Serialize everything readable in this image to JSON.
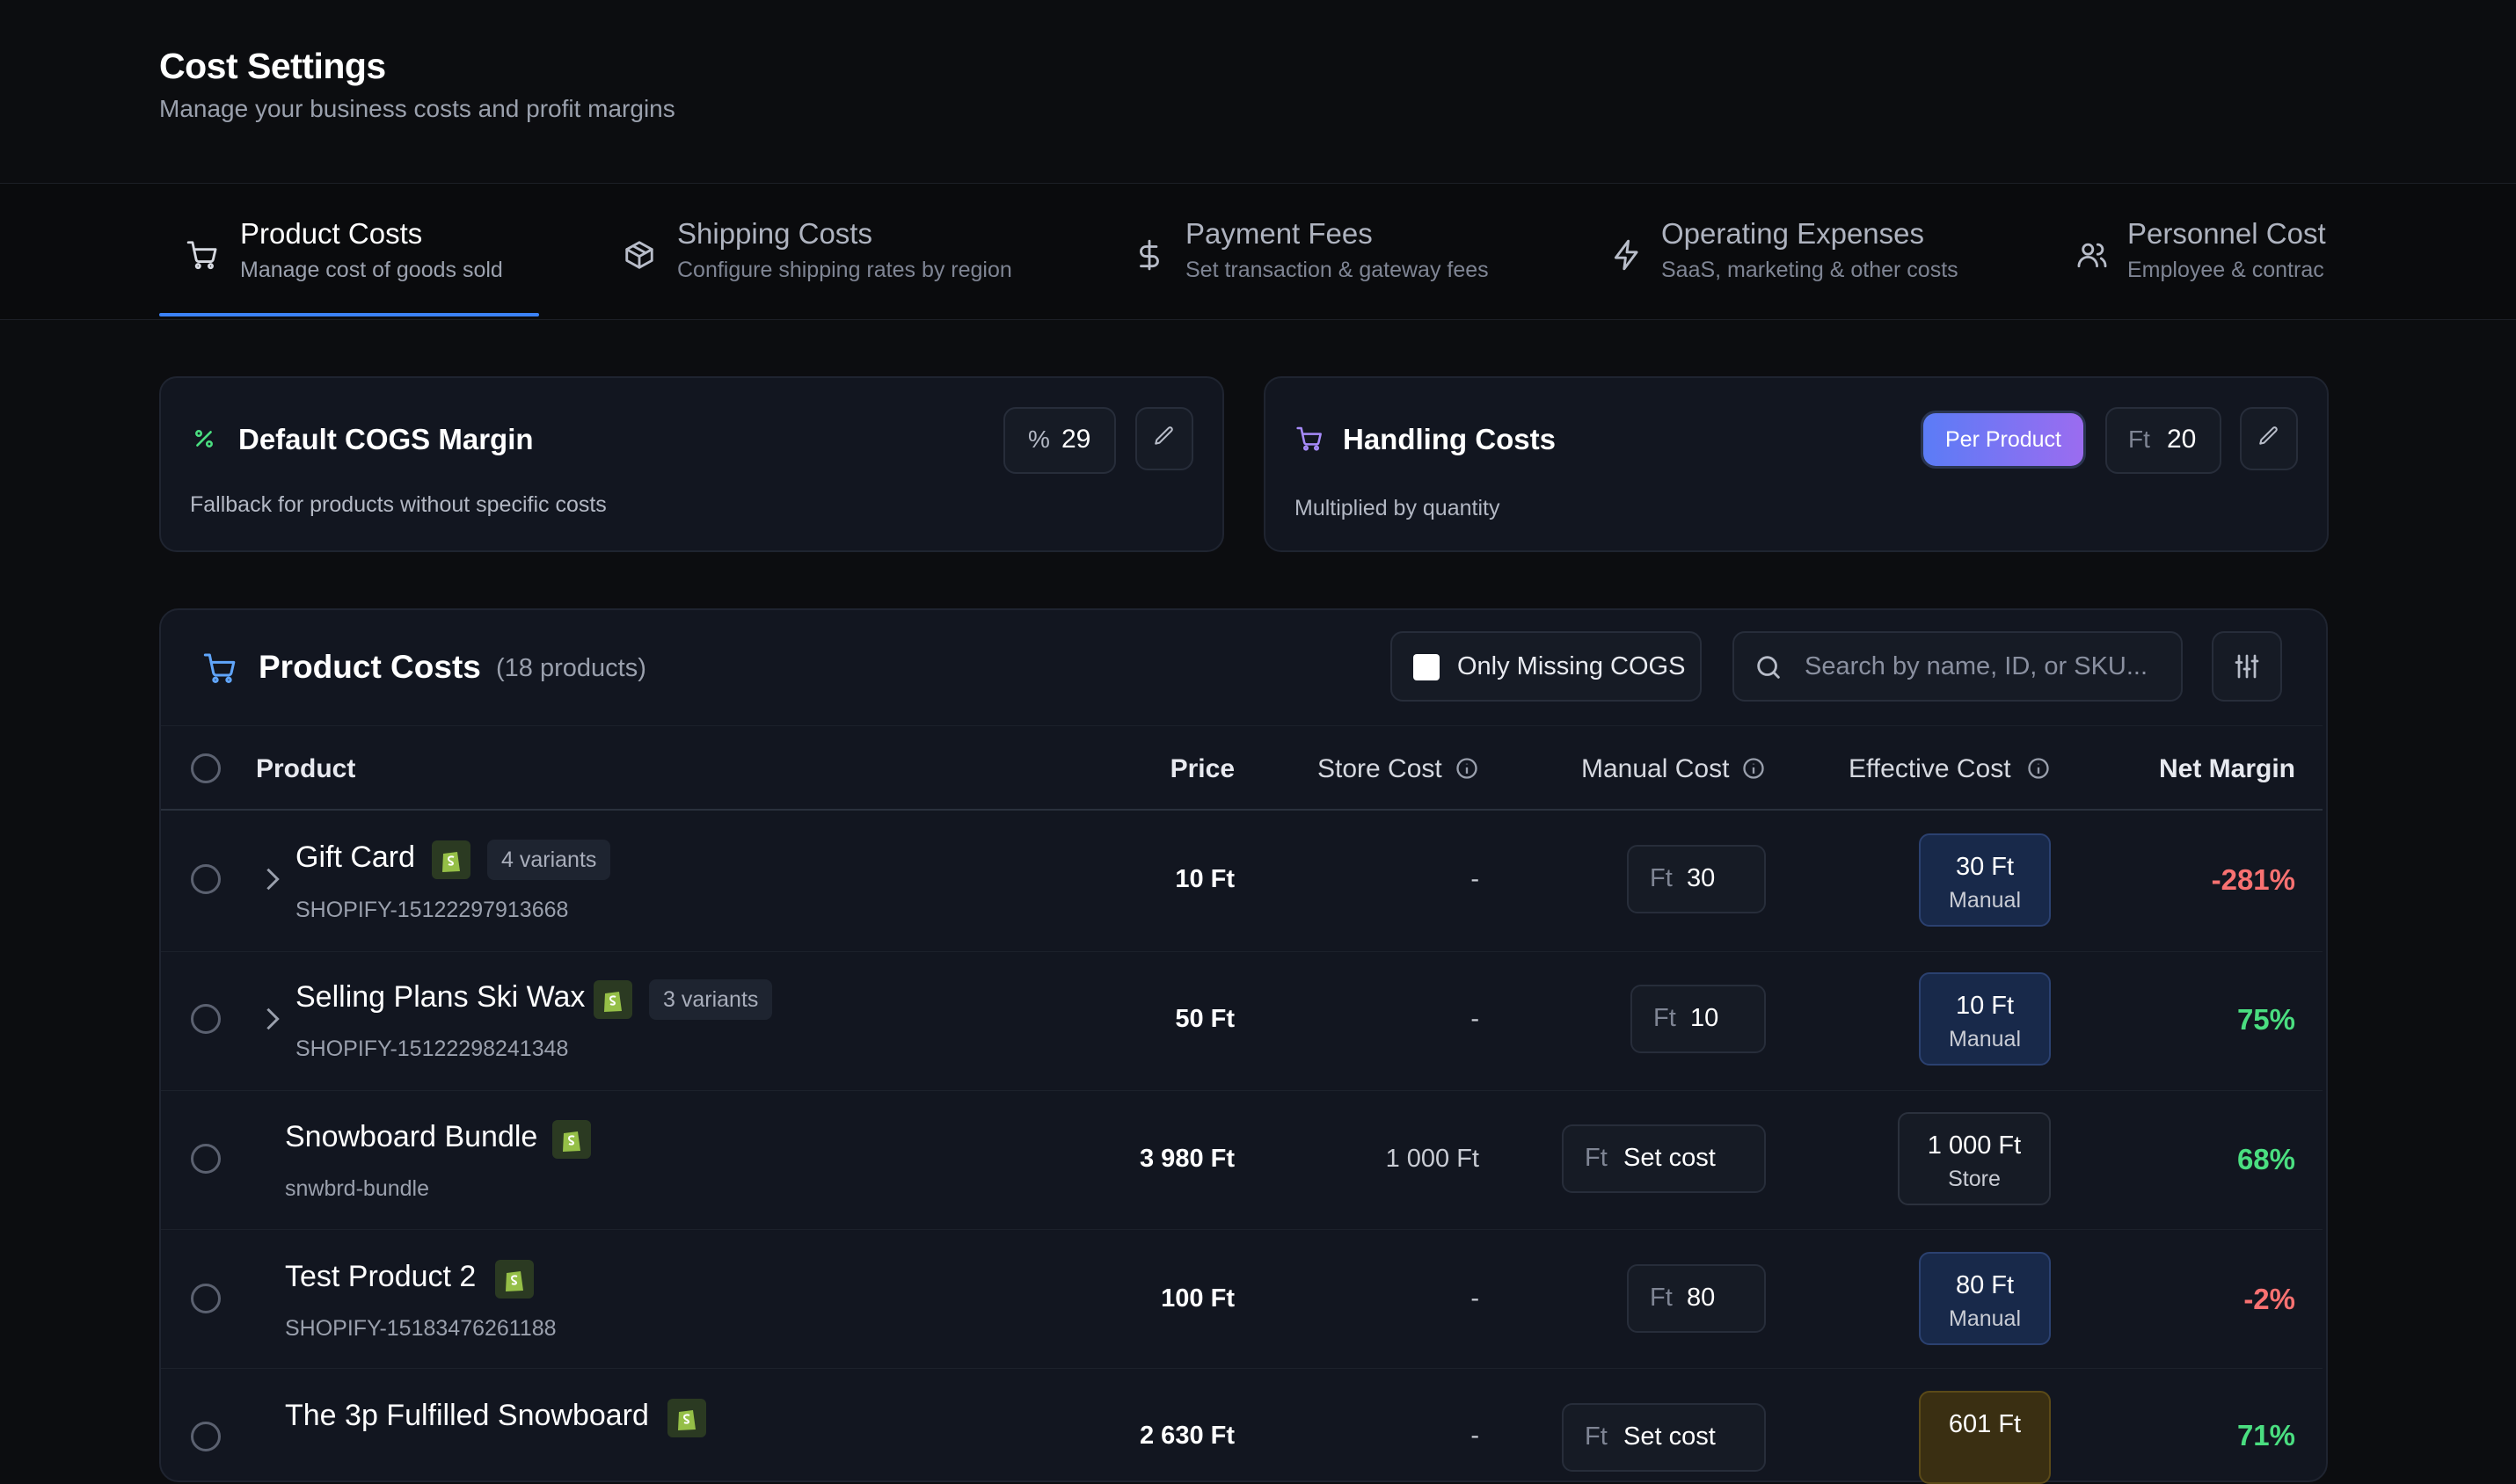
{
  "page": {
    "title": "Cost Settings",
    "subtitle": "Manage your business costs and profit margins"
  },
  "tabs": [
    {
      "label": "Product Costs",
      "sub": "Manage cost of goods sold",
      "icon": "cart-icon",
      "active": true
    },
    {
      "label": "Shipping Costs",
      "sub": "Configure shipping rates by region",
      "icon": "package-icon"
    },
    {
      "label": "Payment Fees",
      "sub": "Set transaction & gateway fees",
      "icon": "dollar-icon"
    },
    {
      "label": "Operating Expenses",
      "sub": "SaaS, marketing & other costs",
      "icon": "bolt-icon"
    },
    {
      "label": "Personnel Cost",
      "sub": "Employee & contrac",
      "icon": "users-icon"
    }
  ],
  "cogs_card": {
    "title": "Default COGS Margin",
    "description": "Fallback for products without specific costs",
    "unit": "%",
    "value": "29",
    "accent": "#4ade80"
  },
  "handling_card": {
    "title": "Handling Costs",
    "description": "Multiplied by quantity",
    "mode_label": "Per Product",
    "currency": "Ft",
    "value": "20",
    "accent": "#a78bfa"
  },
  "product_table": {
    "title": "Product Costs",
    "count": "(18 products)",
    "filter_label": "Only Missing COGS",
    "search_placeholder": "Search by name, ID, or SKU...",
    "columns": {
      "product": "Product",
      "price": "Price",
      "store_cost": "Store Cost",
      "manual_cost": "Manual Cost",
      "effective_cost": "Effective Cost",
      "net_margin": "Net Margin"
    },
    "rows": [
      {
        "name": "Gift Card",
        "variants": "4 variants",
        "sku": "SHOPIFY-15122297913668",
        "price": "10 Ft",
        "store_cost": "-",
        "manual_currency": "Ft",
        "manual_value": "30",
        "effective_value": "30 Ft",
        "effective_source": "Manual",
        "margin": "-281%"
      },
      {
        "name": "Selling Plans Ski Wax",
        "variants": "3 variants",
        "sku": "SHOPIFY-15122298241348",
        "price": "50 Ft",
        "store_cost": "-",
        "manual_currency": "Ft",
        "manual_value": "10",
        "effective_value": "10 Ft",
        "effective_source": "Manual",
        "margin": "75%"
      },
      {
        "name": "Snowboard Bundle",
        "sku": "snwbrd-bundle",
        "price": "3 980 Ft",
        "store_cost": "1 000 Ft",
        "manual_currency": "Ft",
        "manual_value": "Set cost",
        "effective_value": "1 000 Ft",
        "effective_source": "Store",
        "margin": "68%"
      },
      {
        "name": "Test Product 2",
        "sku": "SHOPIFY-15183476261188",
        "price": "100 Ft",
        "store_cost": "-",
        "manual_currency": "Ft",
        "manual_value": "80",
        "effective_value": "80 Ft",
        "effective_source": "Manual",
        "margin": "-2%"
      },
      {
        "name": "The 3p Fulfilled Snowboard",
        "price": "2 630 Ft",
        "store_cost": "-",
        "manual_currency": "Ft",
        "manual_value": "Set cost",
        "effective_value": "601 Ft",
        "margin": "71%"
      }
    ]
  },
  "colors": {
    "accent_blue": "#3b82f6",
    "positive": "#4ade80",
    "negative": "#f87171",
    "shopify": "#95bf47"
  }
}
